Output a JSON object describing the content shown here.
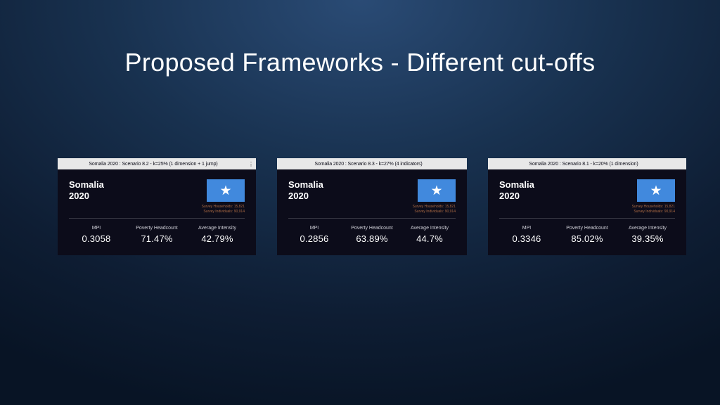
{
  "title": "Proposed Frameworks - Different cut-offs",
  "survey_meta": {
    "households": "Survey Households: 15,821",
    "individuals": "Survey Individuals: 90,914"
  },
  "cards": [
    {
      "scenario": "Somalia 2020 : Scenario 8.2 - k=25% (1 dimension + 1 jump)",
      "country": "Somalia",
      "year": "2020",
      "mpi_label": "MPI",
      "mpi": "0.3058",
      "headcount_label": "Poverty Headcount",
      "headcount": "71.47%",
      "intensity_label": "Average Intensity",
      "intensity": "42.79%"
    },
    {
      "scenario": "Somalia 2020 : Scenario 8.3 - k=27% (4 indicators)",
      "country": "Somalia",
      "year": "2020",
      "mpi_label": "MPI",
      "mpi": "0.2856",
      "headcount_label": "Poverty Headcount",
      "headcount": "63.89%",
      "intensity_label": "Average Intensity",
      "intensity": "44.7%"
    },
    {
      "scenario": "Somalia 2020 : Scenario 8.1 - k=20% (1 dimension)",
      "country": "Somalia",
      "year": "2020",
      "mpi_label": "MPI",
      "mpi": "0.3346",
      "headcount_label": "Poverty Headcount",
      "headcount": "85.02%",
      "intensity_label": "Average Intensity",
      "intensity": "39.35%"
    }
  ]
}
